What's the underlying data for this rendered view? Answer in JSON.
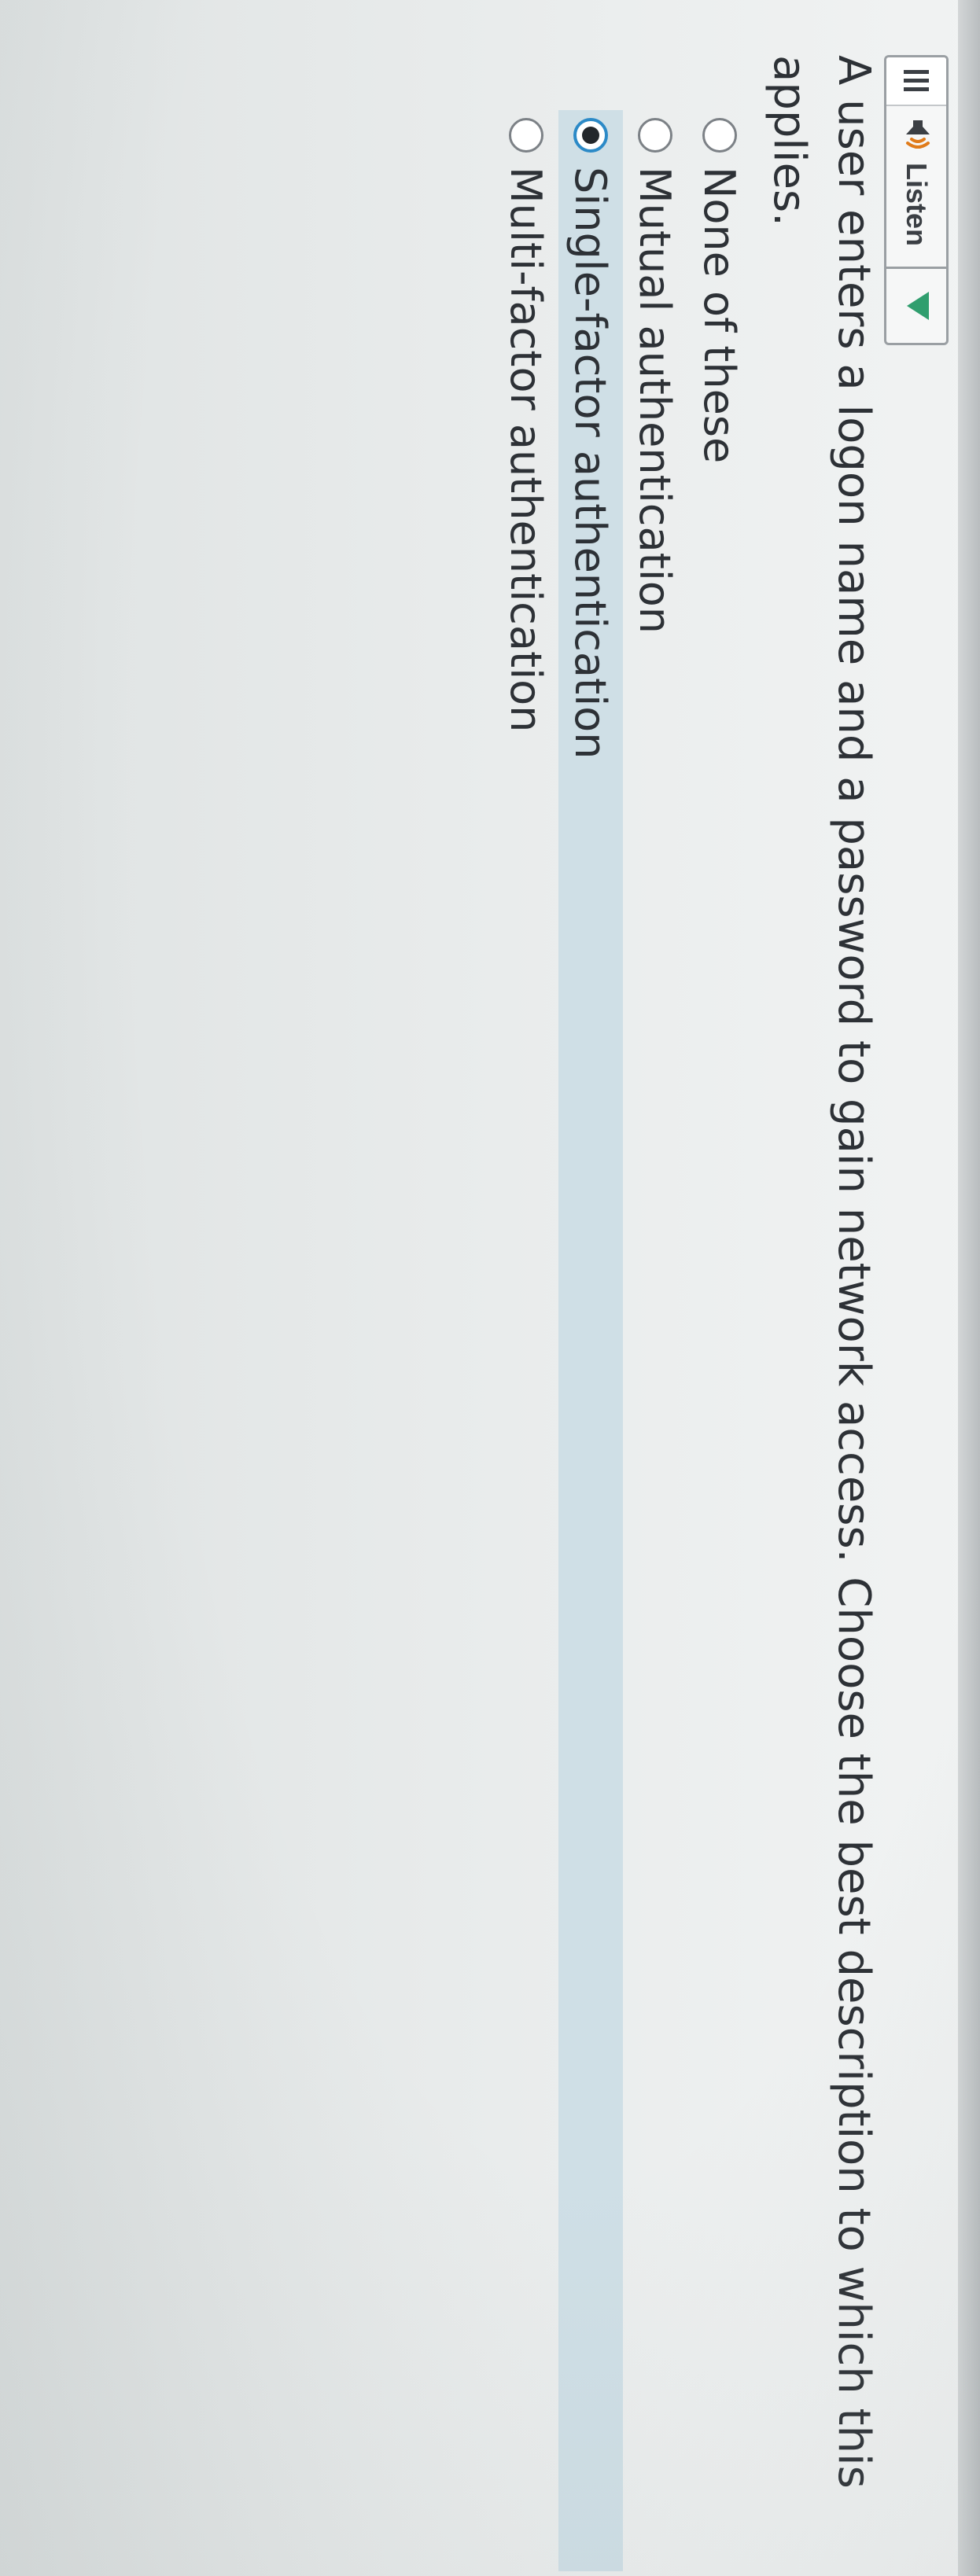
{
  "toolbar": {
    "menu_icon": "grip-lines-icon",
    "speaker_icon": "speaker-icon",
    "listen_label": "Listen",
    "play_icon": "play-triangle-icon",
    "accent_color": "#2f9e6e"
  },
  "question": {
    "text": "A user enters a logon name and a password to gain network access. Choose the best description to which this applies."
  },
  "options": [
    {
      "label": "None of these",
      "selected": false
    },
    {
      "label": "Mutual authentication",
      "selected": false
    },
    {
      "label": "Single-factor authentication",
      "selected": true
    },
    {
      "label": "Multi-factor authentication",
      "selected": false
    }
  ],
  "colors": {
    "selected_row": "#cfdfe6",
    "radio_selected_ring": "#2c8ac7",
    "text": "#2d3136"
  }
}
